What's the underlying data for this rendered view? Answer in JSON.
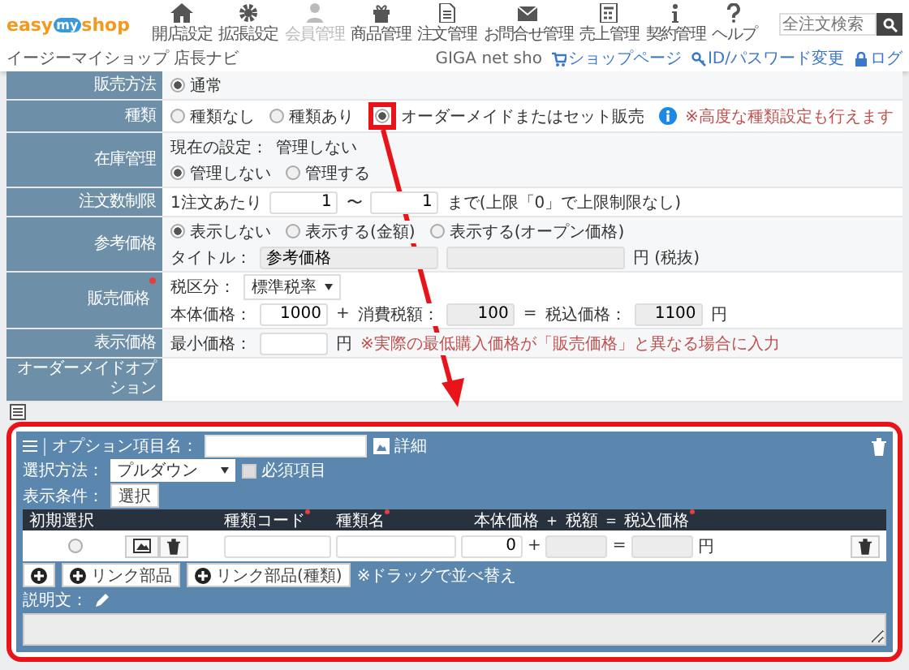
{
  "header": {
    "logo": [
      "easy",
      "my",
      "shop"
    ],
    "app_name": "イージーマイショップ 店長ナビ",
    "nav": [
      {
        "label": "開店設定",
        "disabled": false
      },
      {
        "label": "拡張設定",
        "disabled": false
      },
      {
        "label": "会員管理",
        "disabled": true
      },
      {
        "label": "商品管理",
        "disabled": false
      },
      {
        "label": "注文管理",
        "disabled": false
      },
      {
        "label": "お問合せ管理",
        "disabled": false
      },
      {
        "label": "売上管理",
        "disabled": false
      },
      {
        "label": "契約管理",
        "disabled": false
      },
      {
        "label": "ヘルプ",
        "disabled": false
      }
    ],
    "search": {
      "placeholder": "全注文検索"
    },
    "account": "GIGA net sho",
    "links": [
      "ショップページ",
      "ID/パスワード変更",
      "ログ"
    ]
  },
  "form": {
    "rows": [
      {
        "label": "販売方法",
        "required": false,
        "lines": [
          [
            {
              "kind": "radio",
              "label": "通常",
              "selected": true,
              "annotated": false
            }
          ]
        ]
      },
      {
        "label": "種類",
        "required": false,
        "lines": [
          [
            {
              "kind": "radio",
              "label": "種類なし",
              "selected": false,
              "annotated": false
            },
            {
              "kind": "radio",
              "label": "種類あり",
              "selected": false,
              "annotated": false
            },
            {
              "kind": "radio",
              "label": "オーダーメイドまたはセット販売",
              "selected": true,
              "annotated": true
            },
            {
              "kind": "info"
            },
            {
              "kind": "note",
              "text": "※高度な種類設定も行えます"
            }
          ]
        ]
      },
      {
        "label": "在庫管理",
        "required": false,
        "lines": [
          [
            {
              "kind": "text",
              "text": "現在の設定："
            },
            {
              "kind": "text",
              "text": "管理しない"
            }
          ],
          [
            {
              "kind": "radio",
              "label": "管理しない",
              "selected": true,
              "annotated": false
            },
            {
              "kind": "radio",
              "label": "管理する",
              "selected": false,
              "annotated": false
            }
          ]
        ]
      },
      {
        "label": "注文数制限",
        "required": false,
        "lines": [
          [
            {
              "kind": "text",
              "text": "1注文あたり"
            },
            {
              "kind": "input",
              "value": "1",
              "readonly": false
            },
            {
              "kind": "text",
              "text": "〜"
            },
            {
              "kind": "input",
              "value": "1",
              "readonly": false
            },
            {
              "kind": "text",
              "text": "まで(上限「0」で上限制限なし)"
            }
          ]
        ]
      },
      {
        "label": "参考価格",
        "required": false,
        "lines": [
          [
            {
              "kind": "radio",
              "label": "表示しない",
              "selected": true,
              "annotated": false
            },
            {
              "kind": "radio",
              "label": "表示する(金額)",
              "selected": false,
              "annotated": false
            },
            {
              "kind": "radio",
              "label": "表示する(オープン価格)",
              "selected": false,
              "annotated": false
            }
          ],
          [
            {
              "kind": "text",
              "text": "タイトル："
            },
            {
              "kind": "wide_input",
              "value": "参考価格",
              "readonly": true
            },
            {
              "kind": "wide_input",
              "readonly": true
            },
            {
              "kind": "text",
              "text": "円 (税抜)"
            }
          ]
        ]
      },
      {
        "label": "販売価格",
        "required": true,
        "lines": [
          [
            {
              "kind": "text",
              "text": "税区分："
            },
            {
              "kind": "select",
              "value": "標準税率"
            }
          ],
          [
            {
              "kind": "text",
              "text": "本体価格："
            },
            {
              "kind": "input",
              "value": "1000",
              "readonly": false
            },
            {
              "kind": "text",
              "text": "+"
            },
            {
              "kind": "text",
              "text": "消費税額："
            },
            {
              "kind": "input",
              "value": "100",
              "readonly": true
            },
            {
              "kind": "text",
              "text": "="
            },
            {
              "kind": "text",
              "text": "税込価格："
            },
            {
              "kind": "input",
              "value": "1100",
              "readonly": true
            },
            {
              "kind": "text",
              "text": "円"
            }
          ]
        ]
      },
      {
        "label": "表示価格",
        "required": false,
        "lines": [
          [
            {
              "kind": "text",
              "text": "最小価格："
            },
            {
              "kind": "input",
              "readonly": false
            },
            {
              "kind": "text",
              "text": "円"
            },
            {
              "kind": "note",
              "text": "※実際の最低購入価格が「販売価格」と異なる場合に入力"
            }
          ]
        ]
      },
      {
        "label": "オーダーメイドオプション",
        "required": false,
        "lines": []
      }
    ]
  },
  "option_panel": {
    "name_label": "オプション項目名：",
    "detail": "詳細",
    "method_label": "選択方法：",
    "method": "プルダウン",
    "required_label": "必須項目",
    "required_checked": false,
    "condition_label": "表示条件：",
    "condition_button": "選択",
    "columns": [
      {
        "label": "初期選択",
        "required": false
      },
      {
        "label": "種類コード",
        "required": true
      },
      {
        "label": "種類名",
        "required": true
      },
      {
        "label": "本体価格 ＋ 税額 ＝ 税込価格",
        "required": true
      }
    ],
    "rows": [
      {
        "selected": false,
        "base": "0",
        "plus": "+",
        "equals": "=",
        "unit": "円"
      }
    ],
    "buttons": [
      {
        "kind": "add"
      },
      {
        "kind": "link",
        "label": "リンク部品"
      },
      {
        "kind": "link",
        "label": "リンク部品(種類)"
      }
    ],
    "drag_note": "※ドラッグで並べ替え",
    "description_label": "説明文："
  }
}
